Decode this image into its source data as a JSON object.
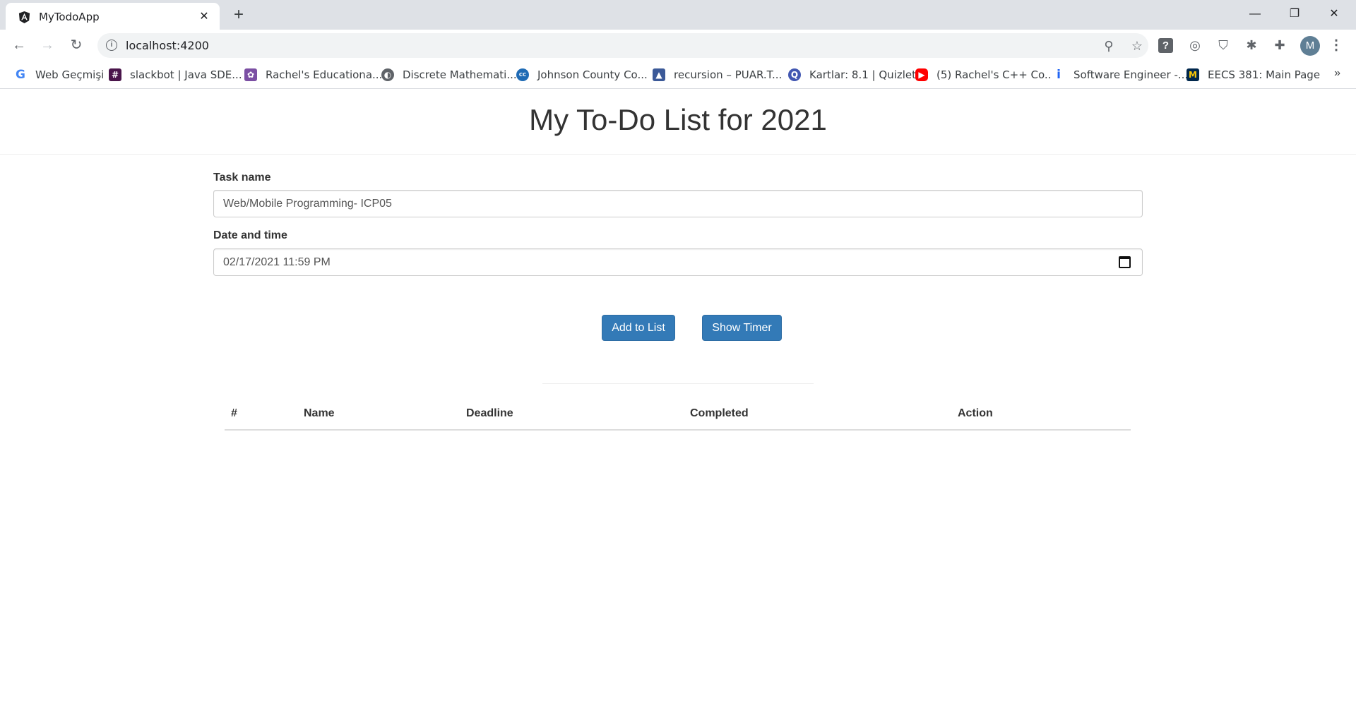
{
  "browser": {
    "tab_title": "MyTodoApp",
    "new_tab_symbol": "+",
    "url": "localhost:4200",
    "avatar_letter": "M",
    "bookmarks": [
      {
        "label": "Web Geçmişi",
        "icon": "google-icon",
        "color": "#4285f4"
      },
      {
        "label": "slackbot | Java SDE...",
        "icon": "slack-icon",
        "color": "#4a154b"
      },
      {
        "label": "Rachel's Educationa...",
        "icon": "puzzle-logo-icon",
        "color": "#7b4fa3"
      },
      {
        "label": "Discrete Mathemati...",
        "icon": "globe-icon",
        "color": "#5f6368"
      },
      {
        "label": "Johnson County Co...",
        "icon": "jccc-icon",
        "color": "#1f6bb5"
      },
      {
        "label": "recursion – PUAR.T...",
        "icon": "bird-icon",
        "color": "#3b5998"
      },
      {
        "label": "Kartlar: 8.1 | Quizlet",
        "icon": "quizlet-icon",
        "color": "#4257b2"
      },
      {
        "label": "(5) Rachel's C++ Co...",
        "icon": "youtube-icon",
        "color": "#ff0000"
      },
      {
        "label": "Software Engineer -...",
        "icon": "indeed-icon",
        "color": "#2164f3"
      },
      {
        "label": "EECS 381: Main Page",
        "icon": "umich-icon",
        "color": "#00274c"
      }
    ],
    "bookmarks_more": "»"
  },
  "app": {
    "title": "My To-Do List for 2021",
    "task_label": "Task name",
    "task_value": "Web/Mobile Programming- ICP05",
    "date_label": "Date and time",
    "date_value": "02/17/2021 11:59 PM",
    "add_button": "Add to List",
    "timer_button": "Show Timer",
    "table_headers": [
      "#",
      "Name",
      "Deadline",
      "Completed",
      "Action"
    ],
    "accent_color": "#337ab7"
  }
}
